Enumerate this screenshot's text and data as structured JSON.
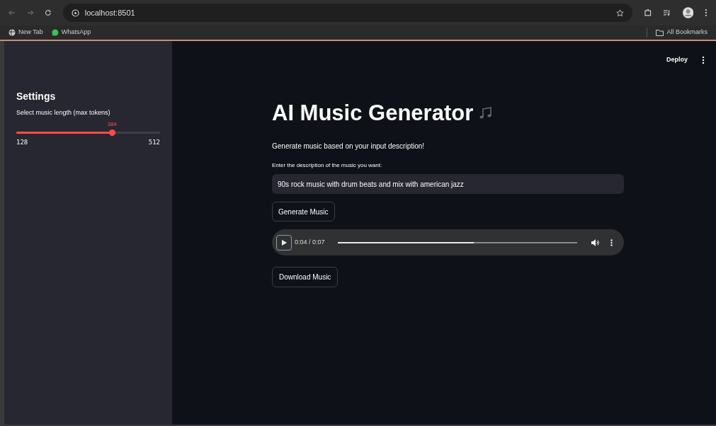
{
  "browser": {
    "url": "localhost:8501",
    "bookmarks": [
      {
        "label": "New Tab",
        "kind": "globe"
      },
      {
        "label": "WhatsApp",
        "kind": "chat"
      }
    ],
    "all_bookmarks": "All Bookmarks"
  },
  "header": {
    "deploy": "Deploy"
  },
  "sidebar": {
    "title": "Settings",
    "slider": {
      "label": "Select music length (max tokens)",
      "value": "384",
      "min": "128",
      "max": "512",
      "level": 0.667
    }
  },
  "main": {
    "title": "AI Music Generator",
    "subtitle": "Generate music based on your input description!",
    "input_label": "Enter the description of the music you want:",
    "input_value": "90s rock music with drum beats and mix with american jazz",
    "generate_button": "Generate Music",
    "player": {
      "time": "0:04 / 0:07",
      "level": 0.57
    },
    "download_button": "Download Music"
  }
}
